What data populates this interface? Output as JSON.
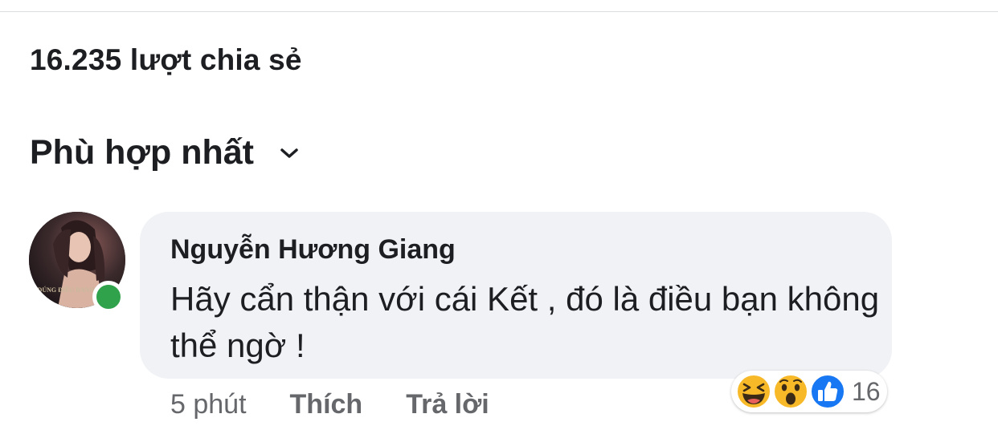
{
  "post": {
    "share_count": "16.235 lượt chia sẻ"
  },
  "sort": {
    "label": "Phù hợp nhất",
    "icon": "chevron-down-icon"
  },
  "comment": {
    "author": "Nguyễn Hương Giang",
    "text": "Hãy cẩn thận với cái Kết , đó là điều bạn không thể ngờ !",
    "avatar_overlay_text": "ĐÚNG ĐIỀU ĐANH ÁNH",
    "online": true,
    "time": "5 phút",
    "like_label": "Thích",
    "reply_label": "Trả lời",
    "reactions": {
      "icons": [
        "haha-icon",
        "wow-icon",
        "like-icon"
      ],
      "count": "16"
    }
  },
  "colors": {
    "online_green": "#31a24c",
    "bubble_bg": "#f0f2f5",
    "secondary_text": "#65676b",
    "like_blue": "#1877f2",
    "reaction_yellow": "#f7b928"
  }
}
